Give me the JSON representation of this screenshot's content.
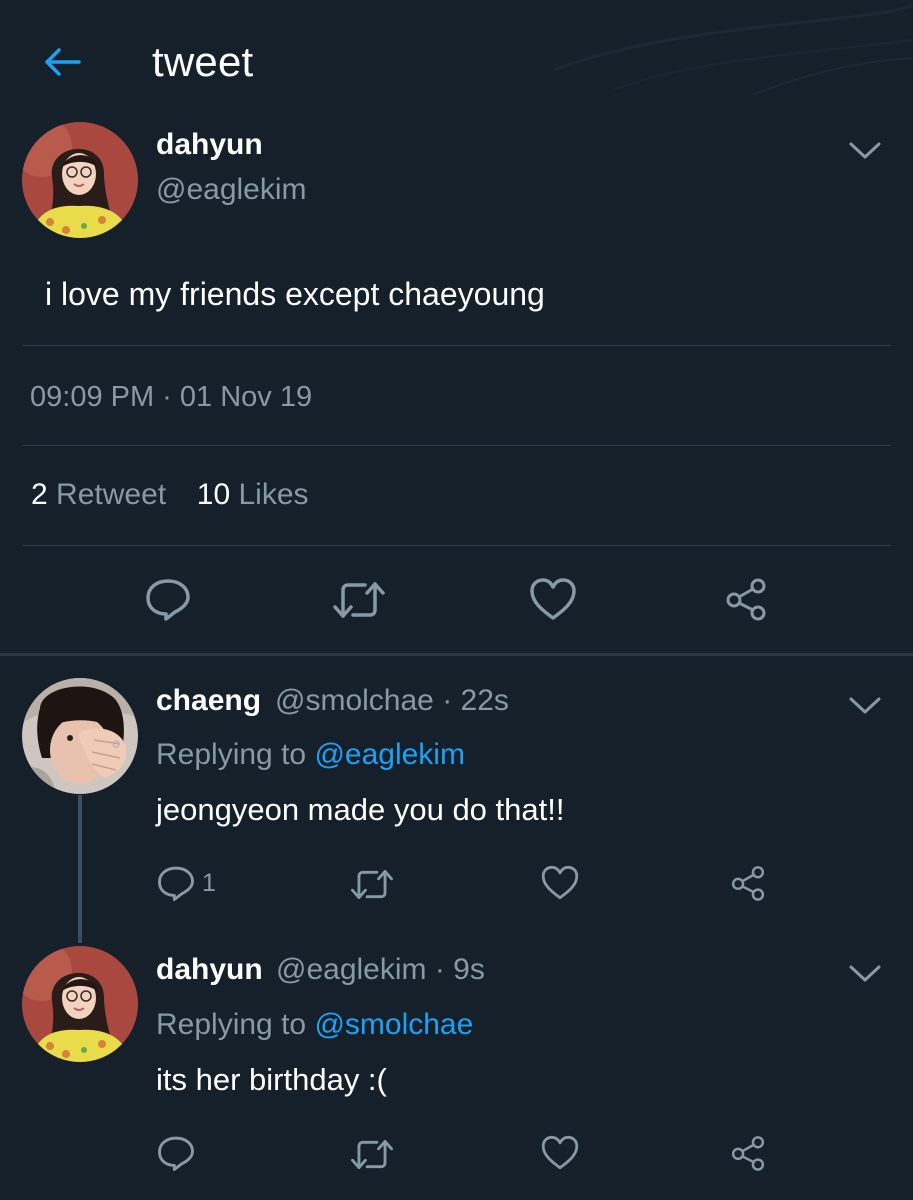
{
  "header": {
    "title": "tweet"
  },
  "main_tweet": {
    "name": "dahyun",
    "handle": "@eaglekim",
    "text": "i love my friends except chaeyoung",
    "timestamp": "09:09 PM · 01 Nov 19",
    "retweets_count": "2",
    "retweets_label": "Retweet",
    "likes_count": "10",
    "likes_label": "Likes"
  },
  "replies": [
    {
      "name": "chaeng",
      "handle": "@smolchae",
      "time": "· 22s",
      "replying_prefix": "Replying to",
      "replying_to": "@eaglekim",
      "text": "jeongyeon made you do that!!",
      "reply_count": "1"
    },
    {
      "name": "dahyun",
      "handle": "@eaglekim",
      "time": "· 9s",
      "replying_prefix": "Replying to",
      "replying_to": "@smolchae",
      "text": "its her birthday :(",
      "reply_count": ""
    }
  ],
  "colors": {
    "background": "#15202b",
    "accent": "#1da1f2",
    "secondary_text": "#8899a6",
    "divider": "#2d3b48"
  },
  "icons": {
    "back": "arrow-left-icon",
    "menu": "chevron-down-icon",
    "reply": "speech-bubble-icon",
    "retweet": "retweet-arrows-icon",
    "like": "heart-icon",
    "share": "share-nodes-icon"
  }
}
